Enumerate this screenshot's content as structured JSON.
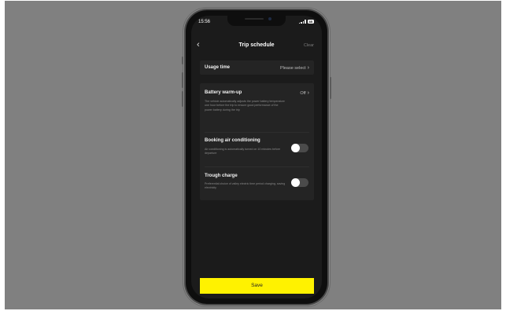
{
  "status_bar": {
    "time": "15:56",
    "battery": "85"
  },
  "nav": {
    "back_icon": "chevron-left-icon",
    "title": "Trip schedule",
    "clear_label": "Clear"
  },
  "usage_time": {
    "label": "Usage time",
    "value": "Please select"
  },
  "battery_warmup": {
    "label": "Battery warm-up",
    "value": "Off",
    "description": "The vehicle automatically adjusts the power battery temperature one hour before the trip to ensure good performance of the power battery during the trip"
  },
  "booking_ac": {
    "label": "Booking air conditioning",
    "description": "Air conditioning is automatically turned on 10 minutes before departure",
    "enabled": false
  },
  "trough_charge": {
    "label": "Trough charge",
    "description": "Preferential choice of valley electric time period charging, saving electricity",
    "enabled": false
  },
  "save_label": "Save",
  "colors": {
    "accent": "#fff200",
    "screen_bg": "#1b1b1b",
    "card_bg": "#242424"
  }
}
